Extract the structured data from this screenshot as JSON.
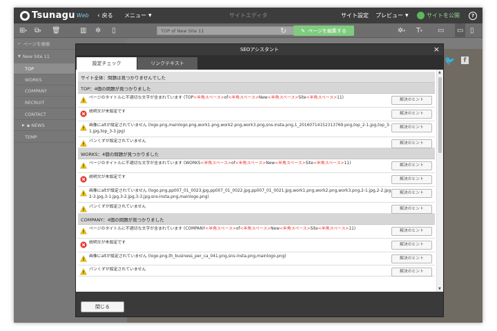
{
  "topbar": {
    "logo": "Tsunagu",
    "logo_sub": "Web",
    "back": "戻る",
    "menu": "メニュー",
    "center_title": "サイトエディタ",
    "site_settings": "サイト設定",
    "preview": "プレビュー",
    "publish": "サイトを公開",
    "help": "?"
  },
  "toolbar": {
    "url_value": "TOP of New Site 11",
    "edit_page": "ページを編集する"
  },
  "sidebar": {
    "search_placeholder": "ページを検索",
    "site_name": "New Site 11",
    "pages": [
      "TOP",
      "WORKS",
      "COMPANY",
      "RECRUIT",
      "CONTACT",
      "NEWS",
      "TEMP"
    ]
  },
  "modal": {
    "title": "SEOアシスタント",
    "close_icon": "×",
    "tabs": [
      "設定チェック",
      "リンクテキスト"
    ],
    "hint_label": "解決のヒント",
    "close_button": "閉じる",
    "sections": [
      {
        "header": "サイト全体：問題は見つかりませんでした",
        "items": []
      },
      {
        "header": "TOP：4個の問題が見つかりました",
        "items": [
          {
            "type": "warning",
            "parts": [
              [
                "ページのタイトルに不適切な文字が含まれています (TOP",
                ""
              ],
              [
                "<半角スペース>",
                "r"
              ],
              [
                "of",
                ""
              ],
              [
                "<半角スペース>",
                "r"
              ],
              [
                "New",
                ""
              ],
              [
                "<半角スペース>",
                "r"
              ],
              [
                "Site",
                ""
              ],
              [
                "<半角スペース>",
                "r"
              ],
              [
                "11)",
                ""
              ]
            ]
          },
          {
            "type": "error",
            "parts": [
              [
                "説明文が未設定です",
                ""
              ]
            ]
          },
          {
            "type": "warning",
            "parts": [
              [
                "画像にaltが設定されていません (logo.png,mainlogo.png,work1.png,work2.png,work3.png,sns-insta.png,1_20160714152313769.png,top_2-1.jpg,top_3-1.jpg,top_3-3.jpg)",
                ""
              ]
            ]
          },
          {
            "type": "warning",
            "parts": [
              [
                "パンくずが設定されていません",
                ""
              ]
            ]
          }
        ]
      },
      {
        "header": "WORKS：4個の問題が見つかりました",
        "items": [
          {
            "type": "warning",
            "parts": [
              [
                "ページのタイトルに不適切な文字が含まれています (WORKS",
                ""
              ],
              [
                "<半角スペース>",
                "r"
              ],
              [
                "of",
                ""
              ],
              [
                "<半角スペース>",
                "r"
              ],
              [
                "New",
                ""
              ],
              [
                "<半角スペース>",
                "r"
              ],
              [
                "Site",
                ""
              ],
              [
                "<半角スペース>",
                "r"
              ],
              [
                "11)",
                ""
              ]
            ]
          },
          {
            "type": "error",
            "parts": [
              [
                "説明文が未設定です",
                ""
              ]
            ]
          },
          {
            "type": "warning",
            "parts": [
              [
                "画像にaltが設定されていません (logo.png,pp007_01_0023.jpg,pp007_01_0022.jpg,pp007_01_0021.jpg,work1.png,work2.png,work3.png,2-1.jpg,2-2.jpg,2-3.jpg,3-1.jpg,3-2.jpg,3-3.jpg,sns-insta.png,mainlogo.png)",
                ""
              ]
            ]
          },
          {
            "type": "warning",
            "parts": [
              [
                "パンくずが設定されていません",
                ""
              ]
            ]
          }
        ]
      },
      {
        "header": "COMPANY：4個の問題が見つかりました",
        "items": [
          {
            "type": "warning",
            "parts": [
              [
                "ページのタイトルに不適切な文字が含まれています (COMPANY",
                ""
              ],
              [
                "<半角スペース>",
                "r"
              ],
              [
                "of",
                ""
              ],
              [
                "<半角スペース>",
                "r"
              ],
              [
                "New",
                ""
              ],
              [
                "<半角スペース>",
                "r"
              ],
              [
                "Site",
                ""
              ],
              [
                "<半角スペース>",
                "r"
              ],
              [
                "11)",
                ""
              ]
            ]
          },
          {
            "type": "error",
            "parts": [
              [
                "説明文が未設定です",
                ""
              ]
            ]
          },
          {
            "type": "warning",
            "parts": [
              [
                "画像にaltが設定されていません (logo.png,th_business_per_ca_041.png,sns-insta.png,mainlogo.png)",
                ""
              ]
            ]
          },
          {
            "type": "warning",
            "parts": [
              [
                "パンくずが設定されていません",
                ""
              ]
            ]
          }
        ]
      }
    ]
  }
}
